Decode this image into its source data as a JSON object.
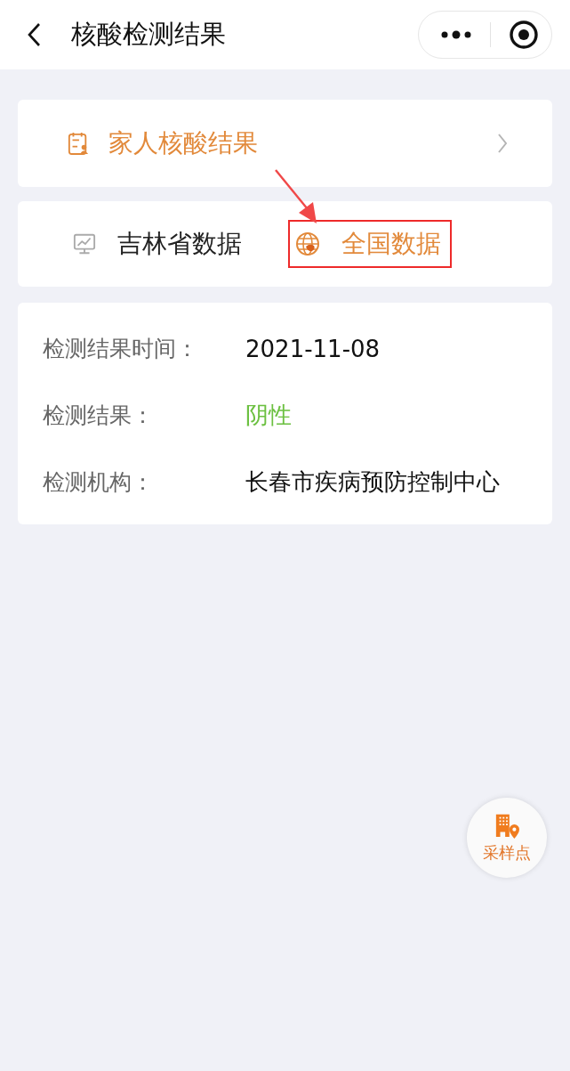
{
  "header": {
    "title": "核酸检测结果"
  },
  "family_link": {
    "label": "家人核酸结果"
  },
  "data_tabs": [
    {
      "label": "吉林省数据",
      "selected": false,
      "highlighted": false
    },
    {
      "label": "全国数据",
      "selected": true,
      "highlighted": true
    }
  ],
  "results": [
    {
      "label": "检测结果时间：",
      "value": "2021-11-08",
      "kind": "plain"
    },
    {
      "label": "检测结果：",
      "value": "阴性",
      "kind": "positive"
    },
    {
      "label": "检测机构：",
      "value": "长春市疾病预防控制中心",
      "kind": "plain"
    }
  ],
  "fab": {
    "label": "采样点"
  }
}
